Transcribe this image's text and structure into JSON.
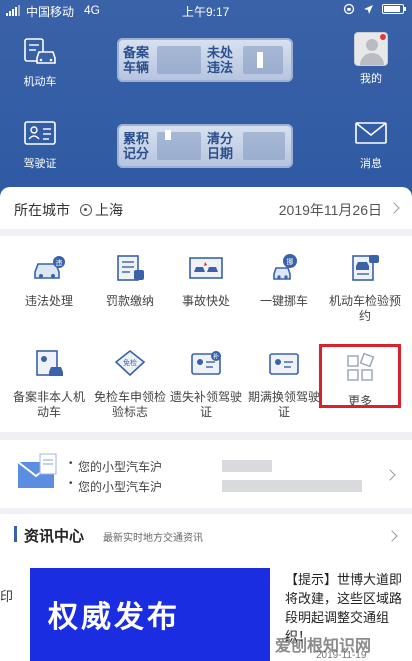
{
  "status": {
    "carrier": "中国移动",
    "network": "4G",
    "time": "上午9:17"
  },
  "header": {
    "vehicle_label": "机动车",
    "license_label": "驾驶证",
    "me_label": "我的",
    "message_label": "消息",
    "plate1": {
      "left": "备案车辆",
      "right": "未处违法"
    },
    "plate2": {
      "left": "累积记分",
      "right": "清分日期"
    }
  },
  "city_row": {
    "label": "所在城市",
    "city": "上海",
    "date": "2019年11月26日"
  },
  "services": [
    {
      "label": "违法处理"
    },
    {
      "label": "罚款缴纳"
    },
    {
      "label": "事故快处"
    },
    {
      "label": "一键挪车"
    },
    {
      "label": "机动车检验预约"
    },
    {
      "label": "备案非本人机动车"
    },
    {
      "label": "免检车申领检验标志"
    },
    {
      "label": "遗失补领驾驶证"
    },
    {
      "label": "期满换领驾驶证"
    },
    {
      "label": "更多"
    }
  ],
  "notifications": [
    {
      "text": "您的小型汽车沪"
    },
    {
      "text": "您的小型汽车沪"
    }
  ],
  "news": {
    "title": "资讯中心",
    "subtitle": "最新实时地方交通资讯",
    "banner_text": "权威发布",
    "edge_char": "印",
    "paragraph": "【提示】世博大道即将改建，这些区域路段明起调整交通组织！",
    "date": "2019-11-19"
  },
  "watermark": "爱刨根知识网",
  "colors": {
    "header_blue": "#3a62a8",
    "highlight_red": "#d8232a",
    "banner_blue": "#1a2de0"
  }
}
